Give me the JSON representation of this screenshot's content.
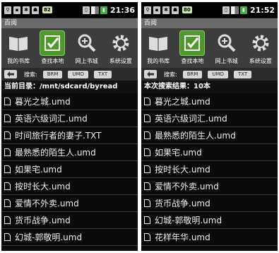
{
  "left": {
    "status": {
      "badge": "82",
      "time": "21:36"
    },
    "title": "百阅",
    "toolbar": [
      "我的书库",
      "查找本地",
      "网上书城",
      "系统设置"
    ],
    "search": {
      "label": "搜索:",
      "filters": [
        "BRM",
        "UMD",
        "TXT"
      ]
    },
    "info": "当前目录：/mnt/sdcard/byread",
    "files": [
      "暮光之城.umd",
      "英语六级词汇.umd",
      "时间旅行者的妻子.TXT",
      "最熟悉的陌生人.umd",
      "如果宅.umd",
      "按时长大.umd",
      "爱情不外卖.umd",
      "货币战争.umd",
      "幻城-郭敬明.umd"
    ]
  },
  "right": {
    "status": {
      "badge": "80",
      "time": "21:52"
    },
    "title": "百阅",
    "toolbar": [
      "我的书库",
      "查找本地",
      "网上书城",
      "系统设置"
    ],
    "search": {
      "label": "搜索:",
      "filters": [
        "BRM",
        "UMD",
        "TXT"
      ]
    },
    "info": "本次搜索结果：10本",
    "files": [
      "暮光之城.umd",
      "英语六级词汇.umd",
      "最熟悉的陌生人.umd",
      "如果宅.umd",
      "按时长大.umd",
      "爱情不外卖.umd",
      "货币战争.umd",
      "幻城-郭敬明.umd",
      "花样年华.umd"
    ]
  },
  "colors": {
    "accent": "#4d9a2a",
    "titlebar": "#6a6a6a",
    "toolbar": "#3d3d3d"
  }
}
